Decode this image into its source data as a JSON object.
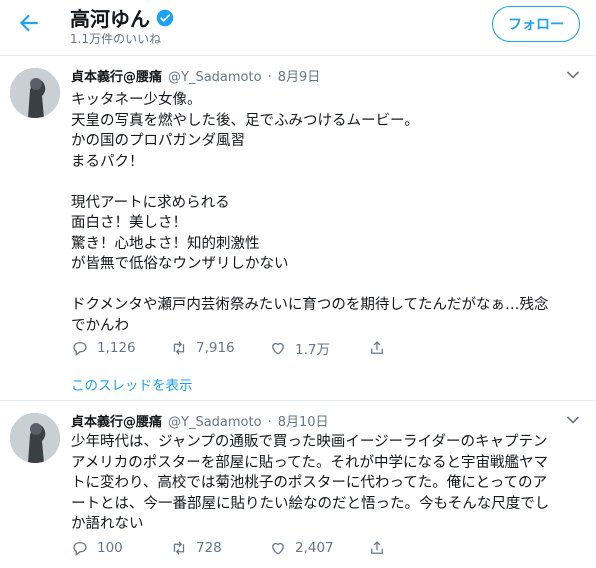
{
  "header": {
    "name": "高河ゆん",
    "likes_count": "1.1万件のいいね",
    "follow_label": "フォロー"
  },
  "colors": {
    "accent": "#1da1f2",
    "muted": "#657786",
    "text": "#14171a",
    "border": "#e6ecf0"
  },
  "icons": [
    "back-arrow-icon",
    "verified-badge-icon",
    "chevron-down-icon",
    "reply-icon",
    "retweet-icon",
    "like-icon",
    "share-icon"
  ],
  "tweets": [
    {
      "author": "貞本義行@腰痛",
      "handle": "@Y_Sadamoto",
      "separator": "·",
      "date": "8月9日",
      "text": "キッタネー少女像。\n天皇の写真を燃やした後、足でふみつけるムービー。\nかの国のプロパガンダ風習\nまるパク！\n\n現代アートに求められる\n面白さ！美しさ！\n驚き！心地よさ！知的刺激性\nが皆無で低俗なウンザリしかない\n\nドクメンタや瀬戸内芸術祭みたいに育つのを期待してたんだがなぁ…残念\nでかんわ",
      "replies": "1,126",
      "retweets": "7,916",
      "likes": "1.7万",
      "thread_link": "このスレッドを表示"
    },
    {
      "author": "貞本義行@腰痛",
      "handle": "@Y_Sadamoto",
      "separator": "·",
      "date": "8月10日",
      "text": "少年時代は、ジャンプの通販で買った映画イージーライダーのキャプテン\nアメリカのポスターを部屋に貼ってた。それが中学になると宇宙戦艦ヤマ\nトに変わり、高校では菊池桃子のポスターに代わってた。俺にとってのア\nートとは、今一番部屋に貼りたい絵なのだと悟った。今もそんな尺度でし\nか語れない",
      "replies": "100",
      "retweets": "728",
      "likes": "2,407"
    }
  ]
}
